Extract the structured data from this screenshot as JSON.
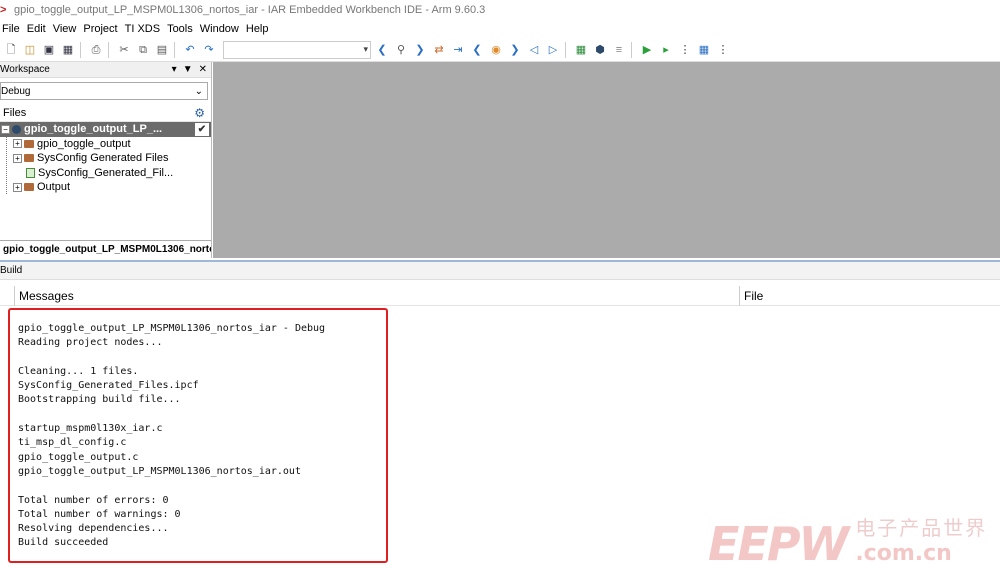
{
  "window": {
    "title": "gpio_toggle_output_LP_MSPM0L1306_nortos_iar - IAR Embedded Workbench IDE - Arm 9.60.3"
  },
  "menubar": {
    "items": [
      "File",
      "Edit",
      "View",
      "Project",
      "TI XDS",
      "Tools",
      "Window",
      "Help"
    ]
  },
  "toolbar": {
    "search_value": ""
  },
  "workspace": {
    "title": "Workspace",
    "configuration": "Debug",
    "files_label": "Files",
    "tree": [
      {
        "label": "gpio_toggle_output_LP_...",
        "type": "project",
        "expanded": true,
        "selected": true
      },
      {
        "label": "gpio_toggle_output",
        "type": "folder"
      },
      {
        "label": "SysConfig Generated Files",
        "type": "folder"
      },
      {
        "label": "SysConfig_Generated_Fil...",
        "type": "file"
      },
      {
        "label": "Output",
        "type": "folder"
      }
    ],
    "bottom_tab": "gpio_toggle_output_LP_MSPM0L1306_norto"
  },
  "build": {
    "title": "Build",
    "columns": {
      "messages": "Messages",
      "file": "File"
    },
    "log": [
      "gpio_toggle_output_LP_MSPM0L1306_nortos_iar - Debug",
      "Reading project nodes...",
      "",
      "Cleaning... 1 files.",
      "SysConfig_Generated_Files.ipcf",
      "Bootstrapping build file...",
      "",
      "startup_mspm0l130x_iar.c",
      "ti_msp_dl_config.c",
      "gpio_toggle_output.c",
      "gpio_toggle_output_LP_MSPM0L1306_nortos_iar.out",
      "",
      "Total number of errors: 0",
      "Total number of warnings: 0",
      "Resolving dependencies...",
      "Build succeeded"
    ]
  },
  "watermark": {
    "brand": "EEPW",
    "cn": "电子产品世界",
    "domain": ".com.cn"
  },
  "colors": {
    "highlight_box": "#e02020",
    "editor_background": "#ababab",
    "selected_row": "#6b6b6b"
  }
}
